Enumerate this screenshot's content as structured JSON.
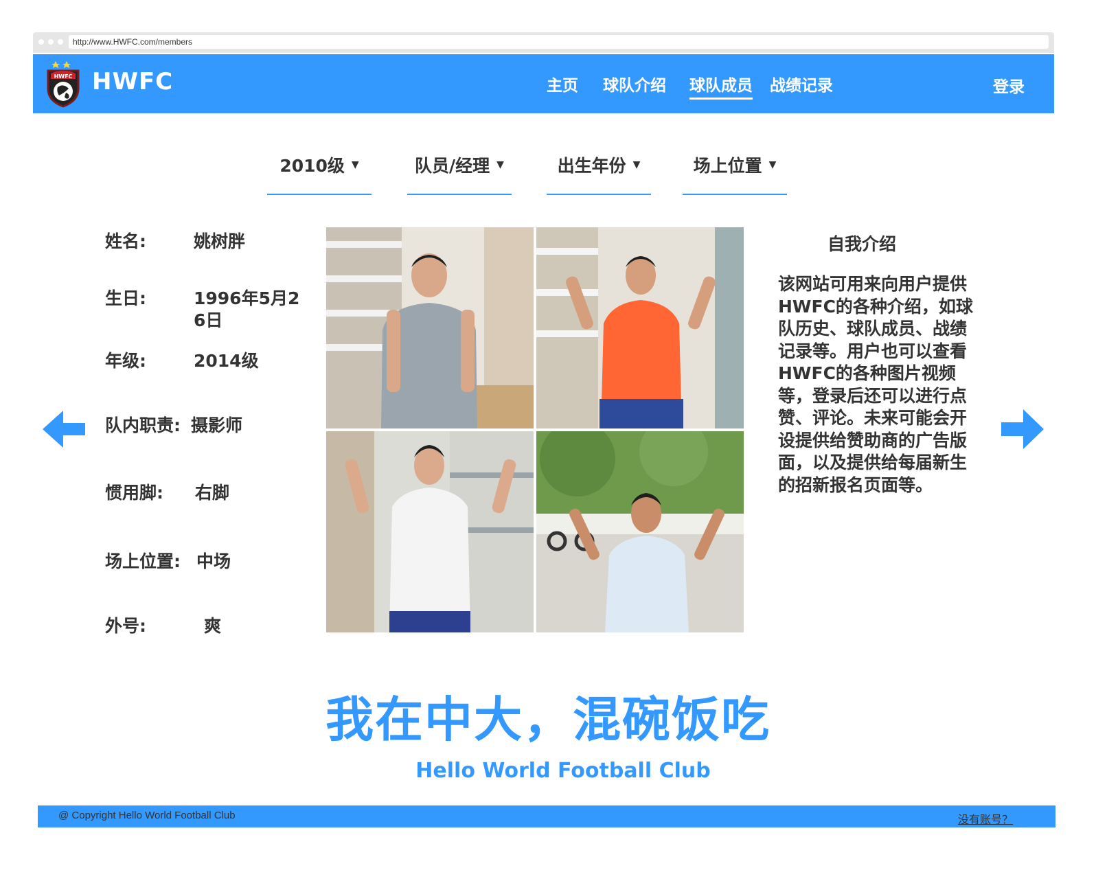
{
  "browser": {
    "url": "http://www.HWFC.com/members"
  },
  "header": {
    "brand": "HWFC",
    "logo_text": "HWFC",
    "nav": [
      {
        "label": "主页"
      },
      {
        "label": "球队介绍"
      },
      {
        "label": "球队成员"
      },
      {
        "label": "战绩记录"
      }
    ],
    "active_nav": "球队成员",
    "login_label": "登录"
  },
  "filters": [
    {
      "label": "2010级"
    },
    {
      "label": "队员/经理"
    },
    {
      "label": "出生年份"
    },
    {
      "label": "场上位置"
    }
  ],
  "member": {
    "name_label": "姓名:",
    "name": "姚树胖",
    "birthday_label": "生日:",
    "birthday": "1996年5月26日",
    "grade_label": "年级:",
    "grade": "2014级",
    "role_label": "队内职责:",
    "role": "摄影师",
    "foot_label": "惯用脚:",
    "foot": "右脚",
    "position_label": "场上位置:",
    "position": "中场",
    "nickname_label": "外号:",
    "nickname": "爽"
  },
  "intro": {
    "title": "自我介绍",
    "text": "该网站可用来向用户提供HWFC的各种介绍，如球队历史、球队成员、战绩记录等。用户也可以查看HWFC的各种图片视频等，登录后还可以进行点赞、评论。未来可能会开设提供给赞助商的广告版面，以及提供给每届新生的招新报名页面等。"
  },
  "slogan": "我在中大，混碗饭吃",
  "club_name": "Hello World Football Club",
  "footer": {
    "copyright": "@ Copyright Hello World Football Club",
    "signup_link": "没有账号？"
  },
  "colors": {
    "accent": "#3399ff",
    "text": "#333333",
    "shirt_orange": "#ff6633"
  },
  "icons": [
    "logo-shield-icon",
    "arrow-left-icon",
    "arrow-right-icon"
  ]
}
